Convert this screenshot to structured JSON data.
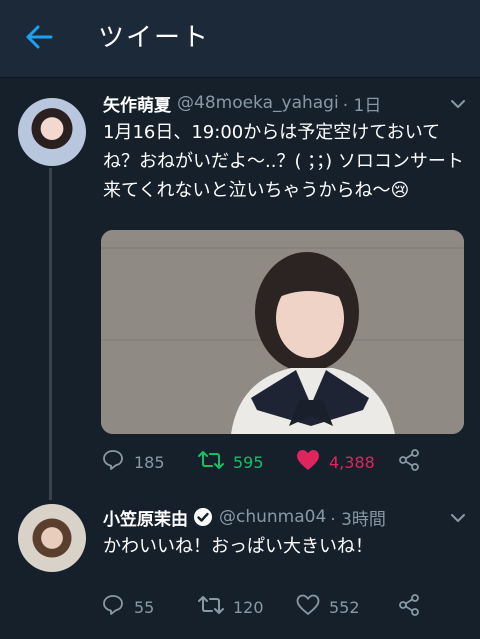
{
  "header": {
    "title": "ツイート",
    "back_icon": "arrow-left-icon",
    "accent": "#1da1f2"
  },
  "tweets": [
    {
      "display_name": "矢作萌夏",
      "handle": "@48moeka_yahagi",
      "time": "· 1日",
      "text": "1月16日、19:00からは予定空けておいてね？おねがいだよ〜..？( ；；) ソロコンサート来てくれないと泣いちゃうからね〜😢",
      "has_media": true,
      "replies": "185",
      "retweets": "595",
      "likes": "4,388",
      "retweeted": true,
      "liked": true
    },
    {
      "display_name": "小笠原茉由",
      "verified": true,
      "handle": "@chunma04",
      "time": "· 3時間",
      "text": "かわいいね！おっぱい大きいね！",
      "replies": "55",
      "retweets": "120",
      "likes": "552",
      "retweeted": false,
      "liked": false
    }
  ],
  "colors": {
    "background": "#15202b",
    "muted": "#8899a6",
    "retweet": "#17bf63",
    "like": "#e0245e"
  }
}
